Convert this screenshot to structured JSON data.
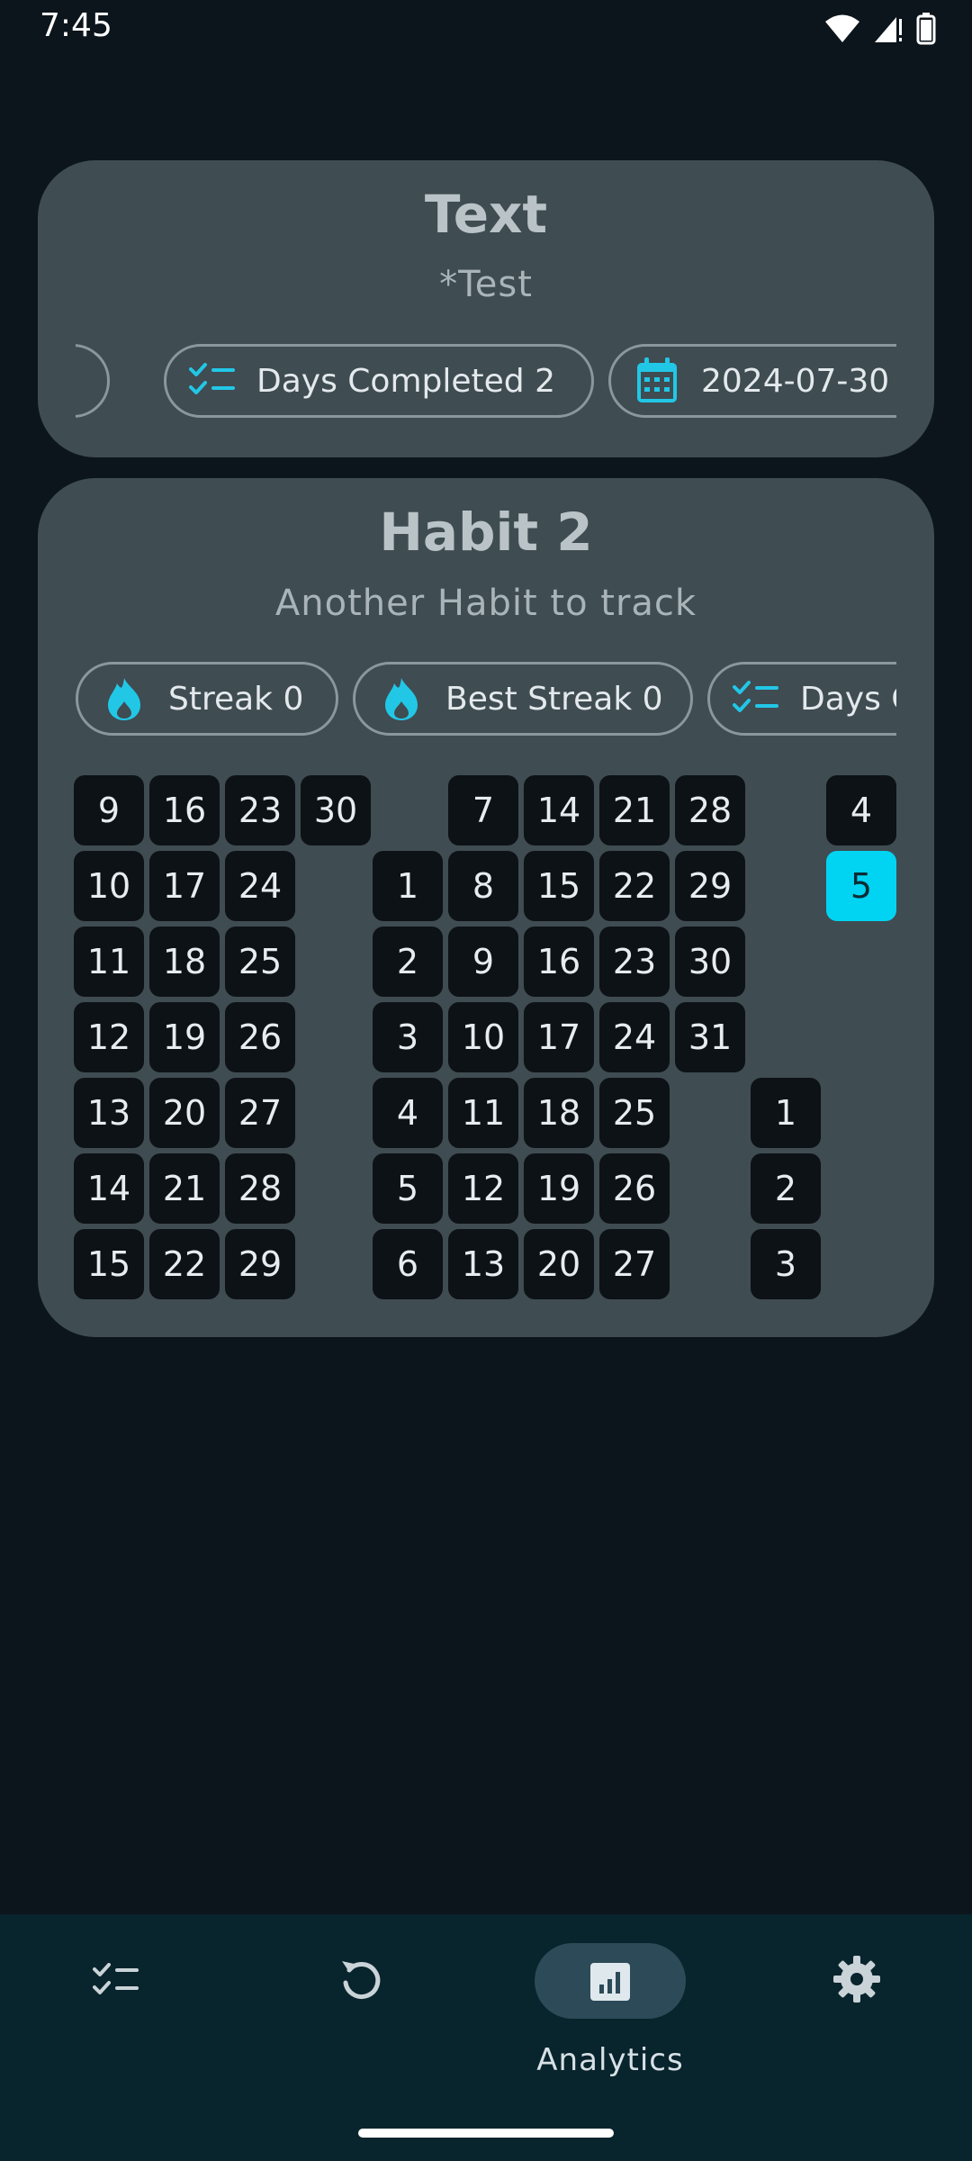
{
  "status": {
    "time": "7:45"
  },
  "card1": {
    "title": "Text",
    "subtitle": "*Test",
    "chips": [
      {
        "label": "Days Completed 2",
        "icon": "checklist-icon"
      },
      {
        "label": "2024-07-30",
        "icon": "calendar-icon"
      }
    ]
  },
  "card2": {
    "title": "Habit 2",
    "subtitle": "Another Habit to track",
    "chips": [
      {
        "label": "Streak 0",
        "icon": "flame-icon"
      },
      {
        "label": "Best Streak 0",
        "icon": "flame-icon"
      },
      {
        "label": "Days C",
        "icon": "checklist-icon"
      }
    ],
    "calendar": {
      "month1": [
        "9",
        "16",
        "23",
        "30",
        "10",
        "17",
        "24",
        "11",
        "18",
        "25",
        "12",
        "19",
        "26",
        "13",
        "20",
        "27",
        "14",
        "21",
        "28",
        "15",
        "22",
        "29"
      ],
      "month2": [
        "7",
        "14",
        "21",
        "28",
        "1",
        "8",
        "15",
        "22",
        "29",
        "2",
        "9",
        "16",
        "23",
        "30",
        "3",
        "10",
        "17",
        "24",
        "31",
        "4",
        "11",
        "18",
        "25",
        "5",
        "12",
        "19",
        "26",
        "6",
        "13",
        "20",
        "27"
      ],
      "month3": [
        "4",
        "5",
        "1",
        "2",
        "3"
      ],
      "today": "5"
    }
  },
  "nav": {
    "items": [
      {
        "name": "habits",
        "icon": "checklist-icon"
      },
      {
        "name": "history",
        "icon": "refresh-icon"
      },
      {
        "name": "analytics",
        "icon": "analytics-icon",
        "label": "Analytics",
        "selected": true
      },
      {
        "name": "settings",
        "icon": "gear-icon"
      }
    ]
  },
  "colors": {
    "accent": "#00d4f2",
    "card": "#3f4c52",
    "background": "#0b151b",
    "nav": "#08242c"
  }
}
